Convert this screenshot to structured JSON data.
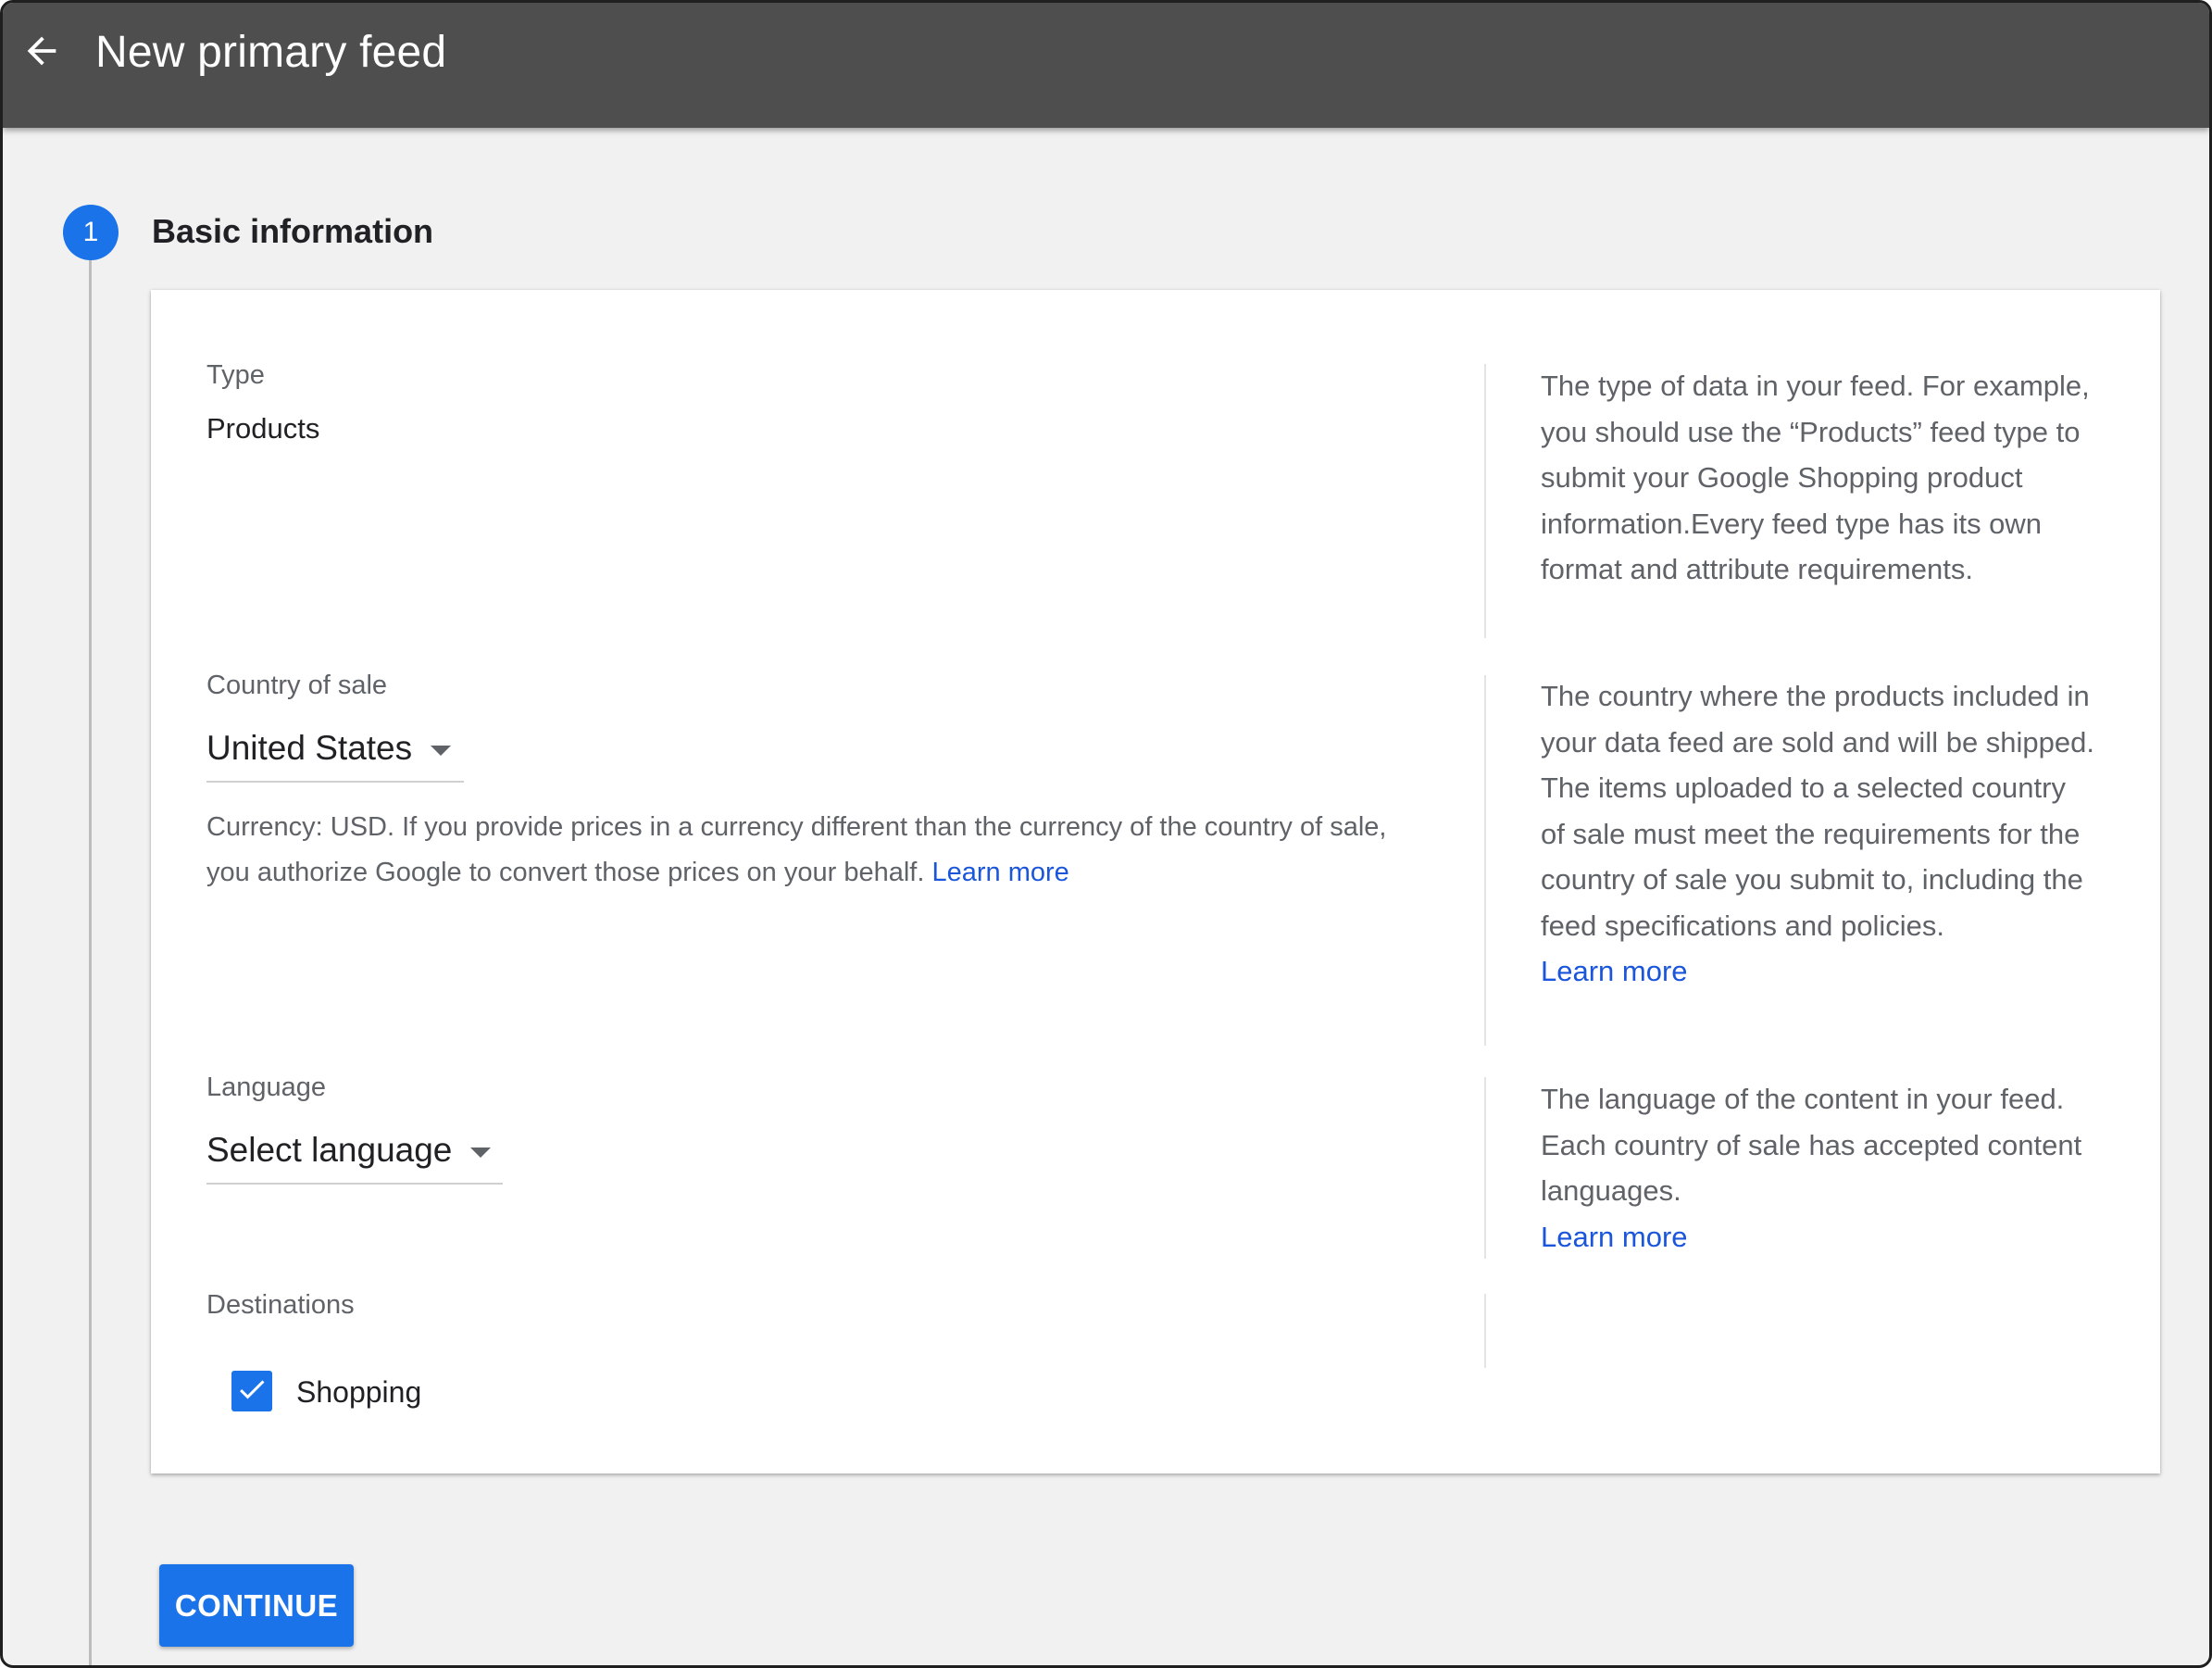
{
  "header": {
    "back_icon": "arrow-back-icon",
    "title": "New primary feed"
  },
  "step": {
    "number": "1",
    "title": "Basic information"
  },
  "type_field": {
    "label": "Type",
    "value": "Products",
    "help": "The type of data in your feed. For example, you should use the “Products” feed type to submit your Google Shopping product information.Every feed type has its own format and attribute requirements."
  },
  "country_field": {
    "label": "Country of sale",
    "selected": "United States",
    "currency_note": "Currency: USD. If you provide prices in a currency different than the currency of the country of sale, you authorize Google to convert those prices on your behalf.",
    "currency_link": "Learn more",
    "help": "The country where the products included in your data feed are sold and will be shipped. The items uploaded to a selected country of sale must meet the requirements for the country of sale you submit to, including the feed specifications and policies.",
    "help_link": "Learn more"
  },
  "language_field": {
    "label": "Language",
    "selected": "Select language",
    "help": "The language of the content in your feed. Each country of sale has accepted content languages.",
    "help_link": "Learn more"
  },
  "destinations": {
    "label": "Destinations",
    "items": [
      {
        "label": "Shopping",
        "checked": true
      }
    ]
  },
  "continue_label": "CONTINUE",
  "colors": {
    "topbar": "#4e4e4e",
    "accent": "#1a73e8",
    "link": "#1a56db",
    "background": "#f1f1f1"
  }
}
